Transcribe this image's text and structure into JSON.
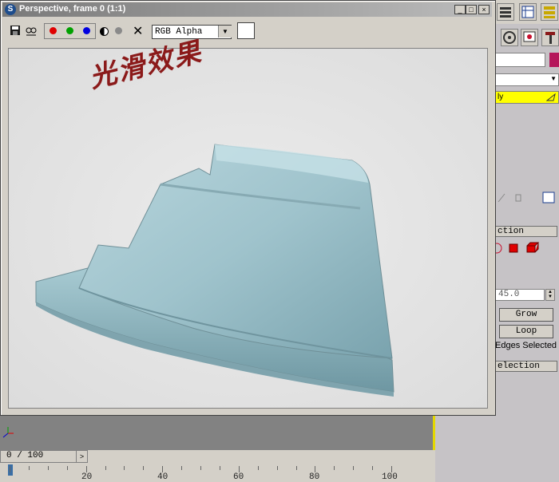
{
  "window": {
    "title": "Perspective, frame 0 (1:1)",
    "channel": "RGB Alpha",
    "minimize_glyph": "_",
    "maximize_glyph": "□",
    "close_glyph": "×",
    "clear_glyph": "✕",
    "dropdown_glyph": "▼"
  },
  "render": {
    "caption": "光滑效果",
    "model_color": "#9fc3cc"
  },
  "command_panel": {
    "modifier_label": "ly",
    "rollout_selection": "ction",
    "spinner_value": "45.0",
    "grow_label": "Grow",
    "loop_label": "Loop",
    "status_text": "Edges Selected",
    "rollout_soft_selection": "election"
  },
  "timeline": {
    "slider_text": "0 / 100",
    "next_glyph": ">",
    "ticks": [
      "20",
      "40",
      "60",
      "80",
      "100"
    ]
  },
  "colors": {
    "accent_yellow": "#ffff00",
    "title_gradient_start": "#7a7a7a",
    "swatch_magenta": "#b5165a"
  }
}
